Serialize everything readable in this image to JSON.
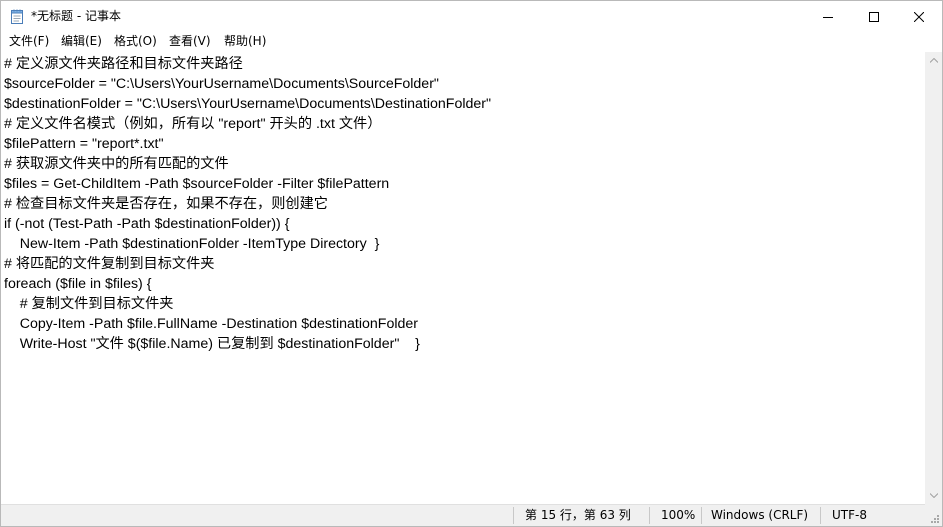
{
  "window": {
    "title": "*无标题 - 记事本"
  },
  "title_controls": {
    "minimize_icon": "minimize-icon",
    "maximize_icon": "maximize-icon",
    "close_icon": "close-icon"
  },
  "menu": {
    "items": [
      {
        "label": "文件(F)"
      },
      {
        "label": "编辑(E)"
      },
      {
        "label": "格式(O)"
      },
      {
        "label": "查看(V)"
      },
      {
        "label": "帮助(H)"
      }
    ]
  },
  "editor": {
    "lines": [
      "# 定义源文件夹路径和目标文件夹路径",
      "$sourceFolder = \"C:\\Users\\YourUsername\\Documents\\SourceFolder\"",
      "$destinationFolder = \"C:\\Users\\YourUsername\\Documents\\DestinationFolder\"",
      "# 定义文件名模式（例如，所有以 \"report\" 开头的 .txt 文件）",
      "$filePattern = \"report*.txt\"",
      "# 获取源文件夹中的所有匹配的文件",
      "$files = Get-ChildItem -Path $sourceFolder -Filter $filePattern",
      "# 检查目标文件夹是否存在，如果不存在，则创建它",
      "if (-not (Test-Path -Path $destinationFolder)) {",
      "    New-Item -Path $destinationFolder -ItemType Directory  }",
      "# 将匹配的文件复制到目标文件夹",
      "foreach ($file in $files) {",
      "    # 复制文件到目标文件夹",
      "    Copy-Item -Path $file.FullName -Destination $destinationFolder",
      "    Write-Host \"文件 $($file.Name) 已复制到 $destinationFolder\"    }"
    ]
  },
  "status": {
    "position": "第 15 行，第 63 列",
    "zoom": "100%",
    "line_ending": "Windows (CRLF)",
    "encoding": "UTF-8"
  }
}
